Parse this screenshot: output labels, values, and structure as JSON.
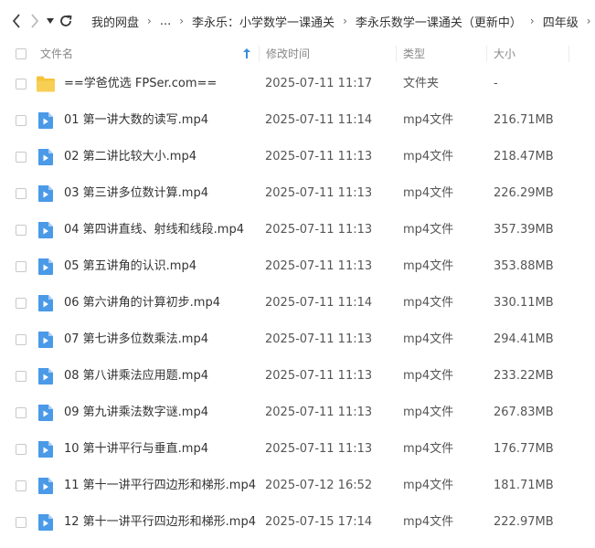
{
  "breadcrumb": [
    "我的网盘",
    "...",
    "李永乐：小学数学一课通关",
    "李永乐数学一课通关（更新中）",
    "四年级"
  ],
  "columns": {
    "name": "文件名",
    "modified": "修改时间",
    "type": "类型",
    "size": "大小"
  },
  "files": [
    {
      "name": "==学爸优选 FPSer.com==",
      "date": "2025-07-11 11:17",
      "type": "文件夹",
      "size": "-",
      "icon": "folder-icon"
    },
    {
      "name": "01 第一讲大数的读写.mp4",
      "date": "2025-07-11 11:14",
      "type": "mp4文件",
      "size": "216.71MB",
      "icon": "video-file-icon"
    },
    {
      "name": "02 第二讲比较大小.mp4",
      "date": "2025-07-11 11:13",
      "type": "mp4文件",
      "size": "218.47MB",
      "icon": "video-file-icon"
    },
    {
      "name": "03 第三讲多位数计算.mp4",
      "date": "2025-07-11 11:13",
      "type": "mp4文件",
      "size": "226.29MB",
      "icon": "video-file-icon"
    },
    {
      "name": "04 第四讲直线、射线和线段.mp4",
      "date": "2025-07-11 11:13",
      "type": "mp4文件",
      "size": "357.39MB",
      "icon": "video-file-icon"
    },
    {
      "name": "05 第五讲角的认识.mp4",
      "date": "2025-07-11 11:13",
      "type": "mp4文件",
      "size": "353.88MB",
      "icon": "video-file-icon"
    },
    {
      "name": "06 第六讲角的计算初步.mp4",
      "date": "2025-07-11 11:14",
      "type": "mp4文件",
      "size": "330.11MB",
      "icon": "video-file-icon"
    },
    {
      "name": "07 第七讲多位数乘法.mp4",
      "date": "2025-07-11 11:13",
      "type": "mp4文件",
      "size": "294.41MB",
      "icon": "video-file-icon"
    },
    {
      "name": "08 第八讲乘法应用题.mp4",
      "date": "2025-07-11 11:13",
      "type": "mp4文件",
      "size": "233.22MB",
      "icon": "video-file-icon"
    },
    {
      "name": "09 第九讲乘法数字谜.mp4",
      "date": "2025-07-11 11:13",
      "type": "mp4文件",
      "size": "267.83MB",
      "icon": "video-file-icon"
    },
    {
      "name": "10 第十讲平行与垂直.mp4",
      "date": "2025-07-11 11:13",
      "type": "mp4文件",
      "size": "176.77MB",
      "icon": "video-file-icon"
    },
    {
      "name": "11 第十一讲平行四边形和梯形.mp4",
      "date": "2025-07-12 16:52",
      "type": "mp4文件",
      "size": "181.71MB",
      "icon": "video-file-icon"
    },
    {
      "name": "12 第十一讲平行四边形和梯形.mp4",
      "date": "2025-07-15 17:14",
      "type": "mp4文件",
      "size": "222.97MB",
      "icon": "video-file-icon"
    }
  ],
  "colors": {
    "accent": "#3a8dde",
    "folder": "#f5c33b",
    "video": "#4a9ae8"
  }
}
